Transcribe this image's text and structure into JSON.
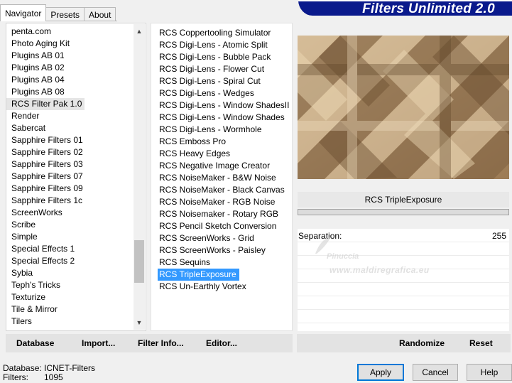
{
  "tabs": [
    {
      "label": "Navigator",
      "active": true
    },
    {
      "label": "Presets",
      "active": false
    },
    {
      "label": "About",
      "active": false
    }
  ],
  "banner_title": "Filters Unlimited 2.0",
  "categories": [
    "penta.com",
    "Photo Aging Kit",
    "Plugins AB 01",
    "Plugins AB 02",
    "Plugins AB 04",
    "Plugins AB 08",
    "RCS Filter Pak 1.0",
    "Render",
    "Sabercat",
    "Sapphire Filters 01",
    "Sapphire Filters 02",
    "Sapphire Filters 03",
    "Sapphire Filters 07",
    "Sapphire Filters 09",
    "Sapphire Filters 1c",
    "ScreenWorks",
    "Scribe",
    "Simple",
    "Special Effects 1",
    "Special Effects 2",
    "Sybia",
    "Teph's Tricks",
    "Texturize",
    "Tile & Mirror",
    "Tilers"
  ],
  "selected_category": "RCS Filter Pak 1.0",
  "filters": [
    "RCS Coppertooling Simulator",
    "RCS Digi-Lens - Atomic Split",
    "RCS Digi-Lens - Bubble Pack",
    "RCS Digi-Lens - Flower Cut",
    "RCS Digi-Lens - Spiral Cut",
    "RCS Digi-Lens - Wedges",
    "RCS Digi-Lens - Window ShadesII",
    "RCS Digi-Lens - Window Shades",
    "RCS Digi-Lens - Wormhole",
    "RCS Emboss Pro",
    "RCS Heavy Edges",
    "RCS Negative Image Creator",
    "RCS NoiseMaker - B&W Noise",
    "RCS NoiseMaker - Black Canvas",
    "RCS NoiseMaker - RGB Noise",
    "RCS Noisemaker - Rotary RGB",
    "RCS Pencil Sketch Conversion",
    "RCS ScreenWorks - Grid",
    "RCS ScreenWorks - Paisley",
    "RCS Sequins",
    "RCS TripleExposure",
    "RCS Un-Earthly Vortex"
  ],
  "selected_filter": "RCS TripleExposure",
  "preview_colors": {
    "light": "#e0c9a6",
    "mid": "#b4946b",
    "dark": "#7e6040"
  },
  "filter_name": "RCS TripleExposure",
  "params": [
    {
      "label": "Separation:",
      "value": "255"
    }
  ],
  "watermark": {
    "name": "Pinuccia",
    "url": "www.maldiregrafica.eu"
  },
  "left_buttons": {
    "database": "Database",
    "import": "Import...",
    "filter_info": "Filter Info...",
    "editor": "Editor..."
  },
  "right_buttons": {
    "randomize": "Randomize",
    "reset": "Reset"
  },
  "status": {
    "database_label": "Database:",
    "database_value": "ICNET-Filters",
    "filters_label": "Filters:",
    "filters_value": "1095"
  },
  "dialog_buttons": {
    "apply": "Apply",
    "cancel": "Cancel",
    "help": "Help"
  }
}
